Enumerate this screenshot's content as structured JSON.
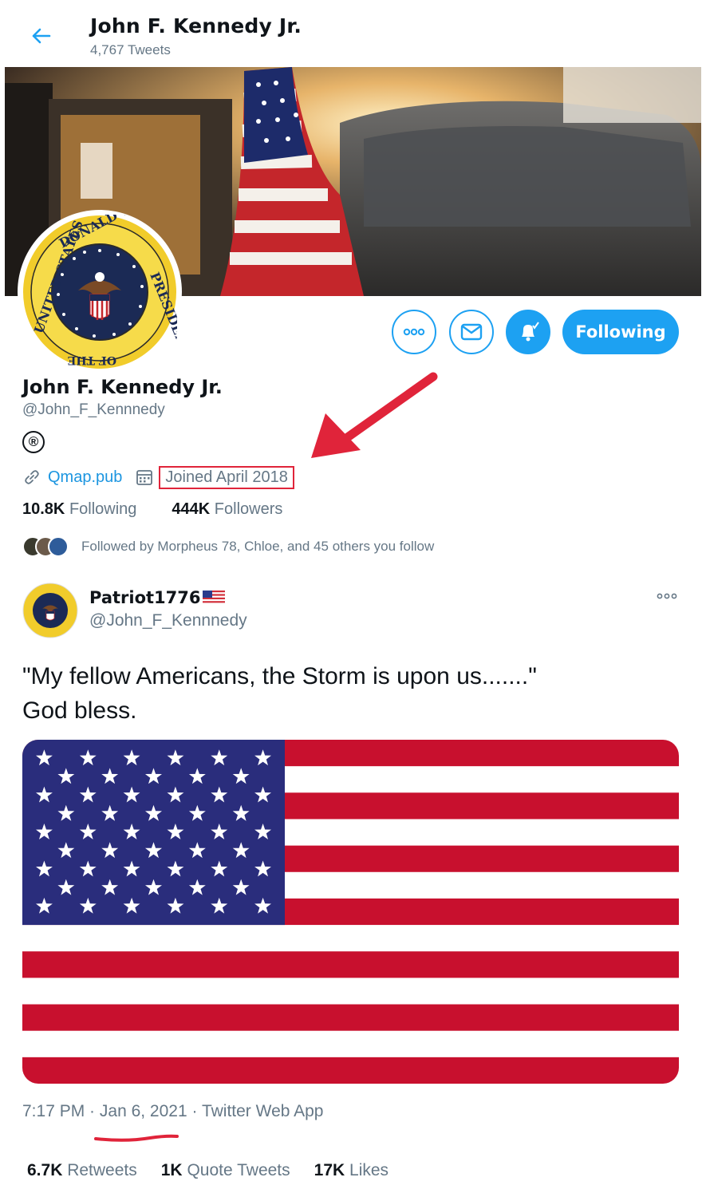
{
  "colors": {
    "accent": "#1da1f2",
    "secondary_text": "#657786",
    "annotation_red": "#e0243a"
  },
  "header": {
    "title": "John F. Kennedy Jr.",
    "tweet_count": "4,767 Tweets"
  },
  "avatar_seal": {
    "top_text": "DONALD TRUMP",
    "side_text": "PRESIDENT",
    "bottom_text": "OF THE",
    "left_text": "UNITED STATES"
  },
  "actions": {
    "more_icon": "more-icon",
    "message_icon": "envelope-icon",
    "notify_icon": "bell-icon",
    "follow_label": "Following"
  },
  "profile": {
    "name": "John F. Kennedy Jr.",
    "handle": "@John_F_Kennnedy",
    "badge": "®",
    "link": "Qmap.pub",
    "joined": "Joined April 2018",
    "following_count": "10.8K",
    "following_label": "Following",
    "followers_count": "444K",
    "followers_label": "Followers",
    "followed_by": "Followed by Morpheus 78, Chloe, and 45 others you follow"
  },
  "tweet": {
    "display_name": "Patriot1776",
    "handle": "@John_F_Kennnedy",
    "text_line1": "\"My fellow Americans, the Storm is upon us.......\"",
    "text_line2": "God bless.",
    "time": "7:17 PM",
    "date": "Jan 6, 2021",
    "source": "Twitter Web App",
    "retweets_count": "6.7K",
    "retweets_label": "Retweets",
    "quotes_count": "1K",
    "quotes_label": "Quote Tweets",
    "likes_count": "17K",
    "likes_label": "Likes"
  }
}
